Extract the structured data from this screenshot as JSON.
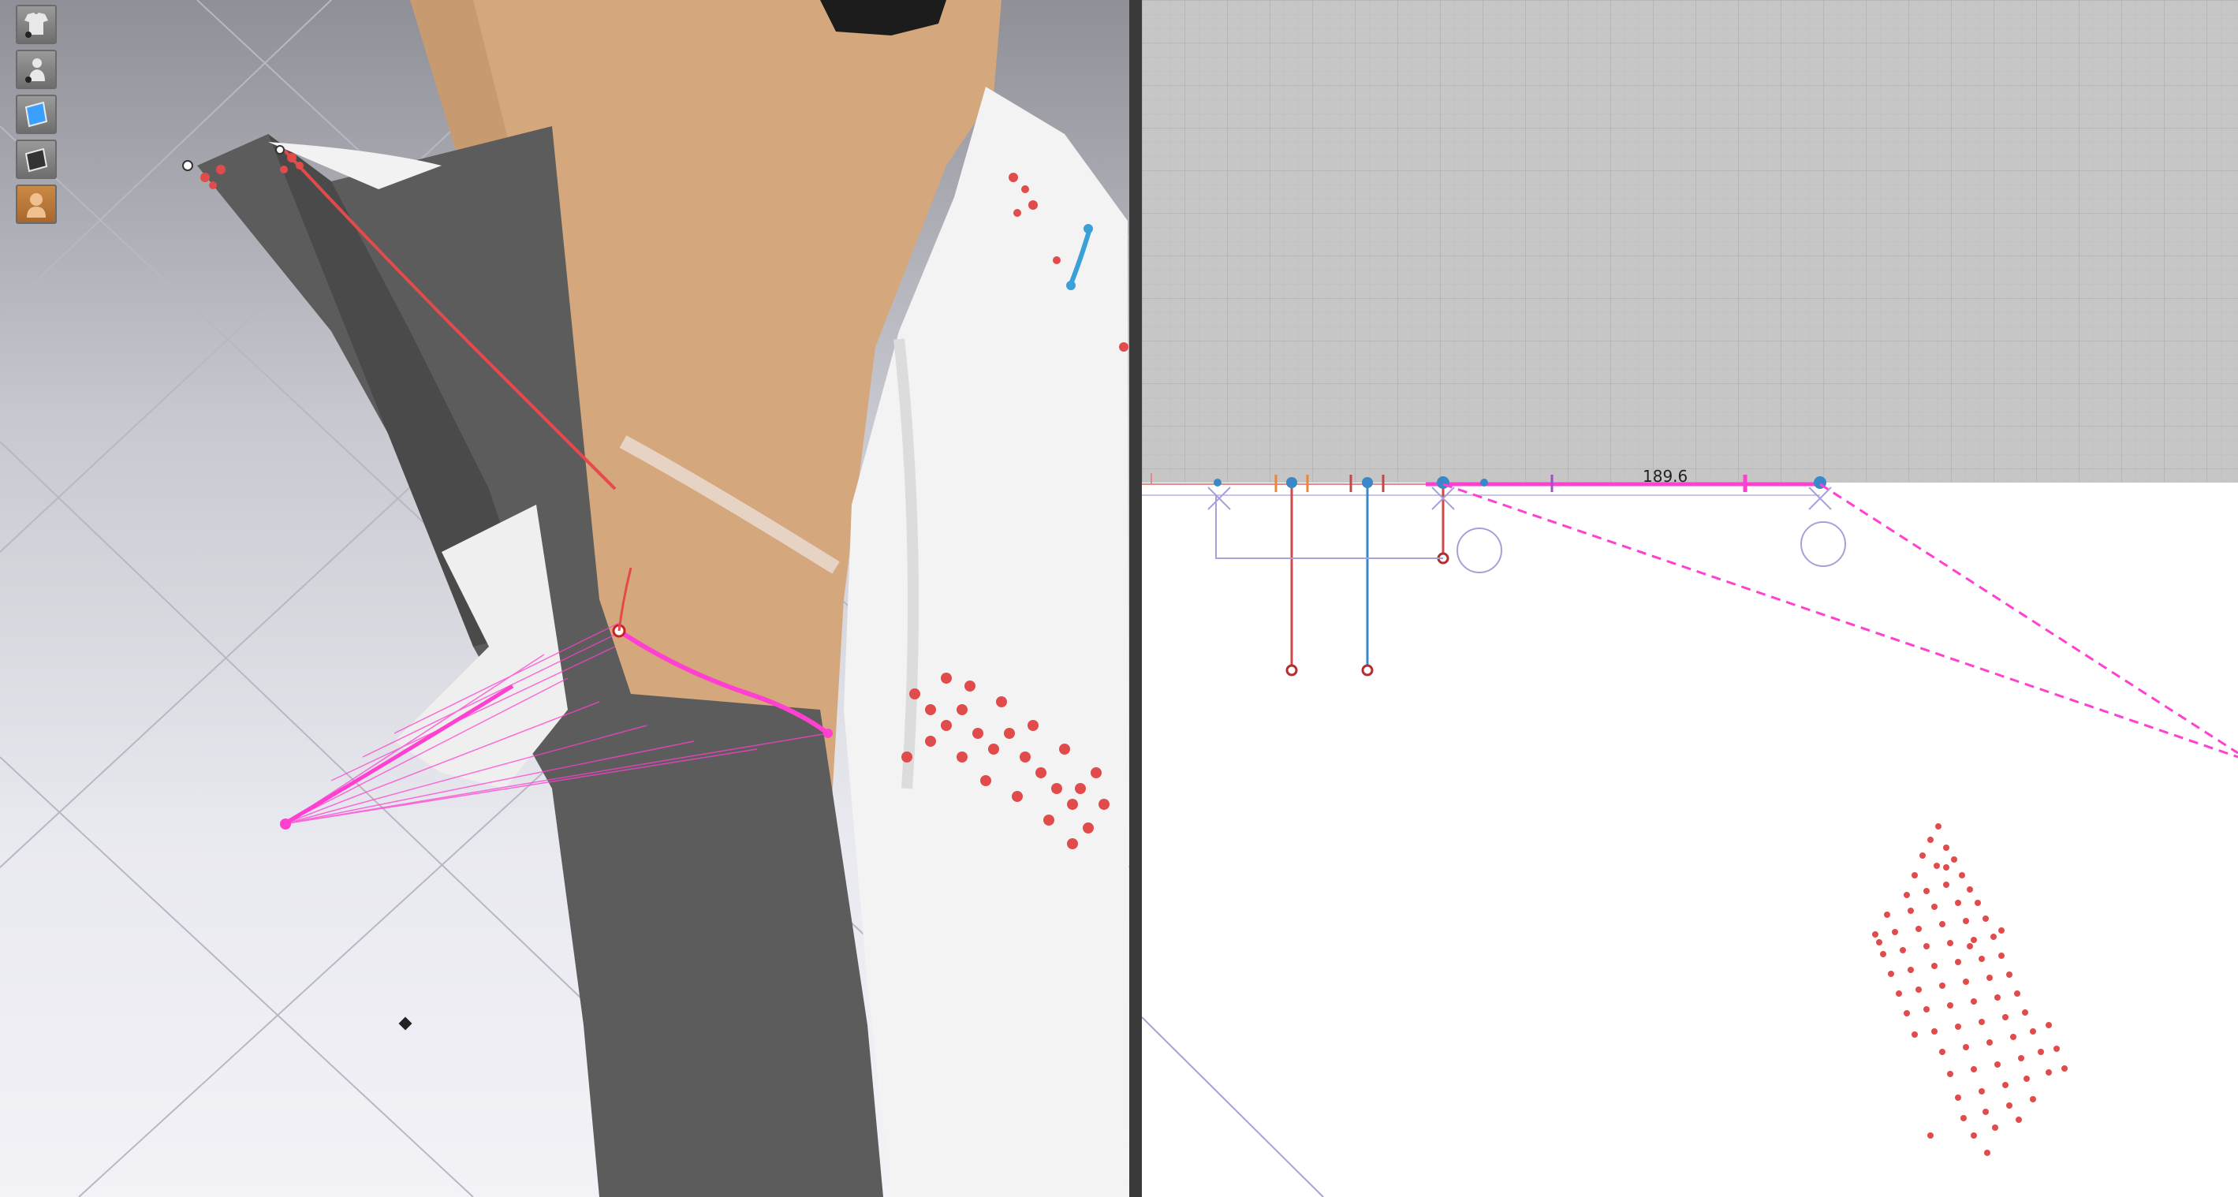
{
  "viewport3d": {
    "toolbar": [
      {
        "id": "show-garment",
        "icon": "garment-visibility-icon"
      },
      {
        "id": "show-avatar",
        "icon": "avatar-visibility-icon"
      },
      {
        "id": "texture",
        "icon": "texture-view-icon"
      },
      {
        "id": "surface",
        "icon": "surface-view-icon"
      },
      {
        "id": "avatar",
        "icon": "avatar-display-icon",
        "active": true
      }
    ]
  },
  "pattern2d": {
    "measurement_label": "189.6"
  },
  "colors": {
    "grid_bg": "#c6c6c6",
    "sewing_magenta": "#ff40d0",
    "pin_red": "#e24b4b",
    "seam_blue": "#3a88c8",
    "fabric_dark": "#5a5a5a",
    "fabric_white": "#f4f4f4",
    "skin": "#d7a97f"
  }
}
